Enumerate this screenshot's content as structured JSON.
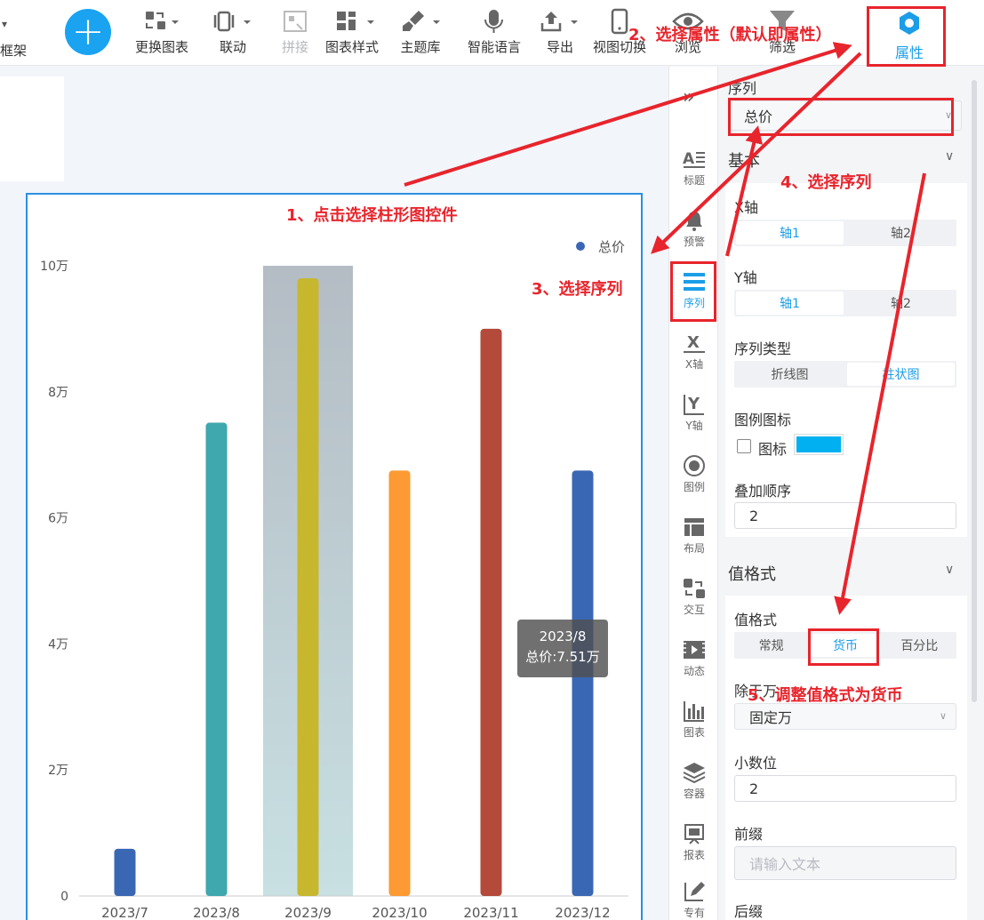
{
  "toolbar": {
    "frame_label": "框架",
    "add_symbol": "+",
    "items": [
      {
        "label": "更换图表",
        "icon": "change-chart-icon"
      },
      {
        "label": "联动",
        "icon": "link-icon"
      },
      {
        "label": "拼接",
        "icon": "splice-icon"
      },
      {
        "label": "图表样式",
        "icon": "chart-style-icon"
      },
      {
        "label": "主题库",
        "icon": "brush-icon"
      },
      {
        "label": "智能语言",
        "icon": "microphone-icon"
      },
      {
        "label": "导出",
        "icon": "export-icon"
      },
      {
        "label": "视图切换",
        "icon": "phone-icon"
      },
      {
        "label": "浏览",
        "icon": "eye-icon"
      },
      {
        "label": "筛选",
        "icon": "filter-icon"
      }
    ],
    "properties_tab": "属性"
  },
  "chart": {
    "tooltip_title": "2023/8",
    "tooltip_value": "总价:7.51万"
  },
  "chart_data": {
    "type": "bar",
    "categories": [
      "2023/7",
      "2023/8",
      "2023/9",
      "2023/10",
      "2023/11",
      "2023/12"
    ],
    "series": [
      {
        "name": "总价",
        "values": [
          7500,
          75100,
          98000,
          67500,
          90000,
          67500
        ]
      }
    ],
    "bar_colors": [
      "#3a67b4",
      "#3fa7ae",
      "#c7b72e",
      "#fd9a33",
      "#b34a3a",
      "#3a67b4"
    ],
    "legend_marker_color": "#3a67b4",
    "highlight_category": "2023/9",
    "ylim": [
      0,
      100000
    ],
    "yticks": [
      0,
      20000,
      40000,
      60000,
      80000,
      100000
    ],
    "ytick_labels": [
      "0",
      "2万",
      "4万",
      "6万",
      "8万",
      "10万"
    ],
    "legend_position": "top-right",
    "grid": false
  },
  "side_bar": {
    "collapse_icon": "»",
    "items": [
      {
        "label": "标题",
        "icon": "title-icon"
      },
      {
        "label": "预警",
        "icon": "bell-icon"
      },
      {
        "label": "序列",
        "icon": "list-icon"
      },
      {
        "label": "X轴",
        "icon": "x-axis-icon"
      },
      {
        "label": "Y轴",
        "icon": "y-axis-icon"
      },
      {
        "label": "图例",
        "icon": "legend-icon"
      },
      {
        "label": "布局",
        "icon": "layout-icon"
      },
      {
        "label": "交互",
        "icon": "interaction-icon"
      },
      {
        "label": "动态",
        "icon": "animation-icon"
      },
      {
        "label": "图表",
        "icon": "chart-icon"
      },
      {
        "label": "容器",
        "icon": "layers-icon"
      },
      {
        "label": "报表",
        "icon": "report-icon"
      },
      {
        "label": "专有",
        "icon": "edit-icon"
      }
    ]
  },
  "panel": {
    "series_label": "序列",
    "series_value": "总价",
    "basic_title": "基本",
    "x_axis_label": "X轴",
    "x_axis_options": [
      "轴1",
      "轴2"
    ],
    "y_axis_label": "Y轴",
    "y_axis_options": [
      "轴1",
      "轴2"
    ],
    "series_type_label": "序列类型",
    "series_type_options": [
      "折线图",
      "柱状图"
    ],
    "legend_icon_label": "图例图标",
    "legend_icon_checkbox": "图标",
    "legend_icon_color": "#00b0f0",
    "stack_order_label": "叠加顺序",
    "stack_order_value": "2",
    "value_format_title": "值格式",
    "value_format_label": "值格式",
    "value_format_options": [
      "常规",
      "货币",
      "百分比"
    ],
    "divide_label": "除于万",
    "divide_value": "固定万",
    "decimals_label": "小数位",
    "decimals_value": "2",
    "prefix_label": "前缀",
    "prefix_placeholder": "请输入文本",
    "suffix_label": "后缀"
  },
  "annotations": {
    "step1": "1、点击选择柱形图控件",
    "step2": "2、选择属性（默认即属性）",
    "step3": "3、选择序列",
    "step4": "4、选择序列",
    "step5": "5、调整值格式为货币",
    "color": "#e8242c"
  }
}
